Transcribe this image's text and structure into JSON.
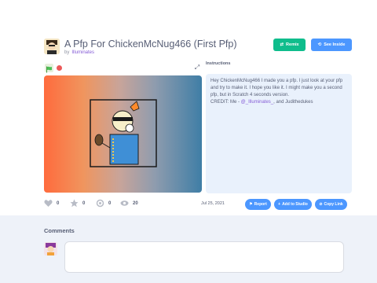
{
  "project": {
    "title": "A Pfp For ChickenMcNug466 (First Pfp)",
    "by_label": "by",
    "author": "Illuminates"
  },
  "header_buttons": {
    "remix": "Remix",
    "see_inside": "See Inside"
  },
  "instructions": {
    "label": "Instructions",
    "text": "Hey ChickenMcNug466 I made you a pfp. I just look at your pfp and try to make it. I hope you like it. I might make you a second pfp, but in Scratch 4 seconds version.",
    "credit_prefix": "CREDIT: Me - ",
    "credit_mention": "@_Illuminates_",
    "credit_suffix": ", and Judithedukes"
  },
  "stats": {
    "loves": "0",
    "favorites": "0",
    "remixes": "0",
    "views": "20"
  },
  "shared_date": "Jul 25, 2021",
  "actions": {
    "report": "Report",
    "add_studio": "Add to Studio",
    "copy_link": "Copy Link"
  },
  "comments": {
    "title": "Comments"
  },
  "colors": {
    "remix_green": "#0fbd8c",
    "scratch_blue": "#4c97ff",
    "text": "#575e75",
    "link_purple": "#855cd6",
    "stop_red": "#ec5959"
  },
  "icons": [
    "remix-icon",
    "see-inside-icon",
    "green-flag-icon",
    "stop-icon",
    "fullscreen-icon",
    "heart-icon",
    "star-icon",
    "remix-count-icon",
    "eye-icon",
    "flag-report-icon",
    "plus-icon",
    "link-icon"
  ]
}
